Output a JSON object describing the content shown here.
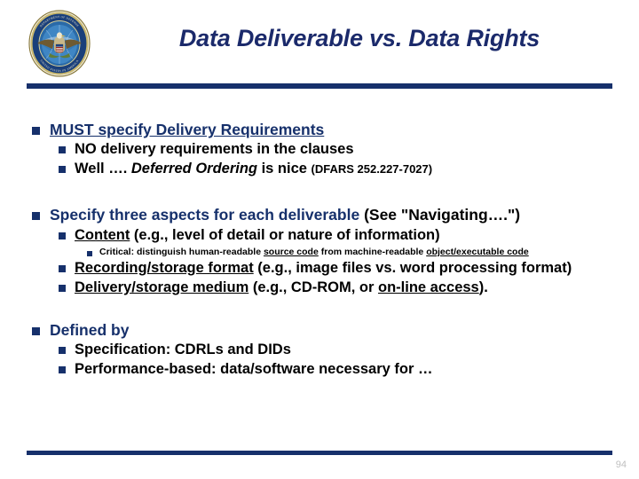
{
  "slide": {
    "title": "Data Deliverable vs. Data Rights",
    "page_number": "94",
    "accent_color": "#16306b",
    "title_color": "#1b2a6b",
    "seal_name": "department-of-defense-seal",
    "seal_text_top": "DEPARTMENT OF DEFENSE",
    "seal_text_bottom": "UNITED STATES OF AMERICA"
  },
  "bullets": {
    "b1": {
      "heading": "MUST specify Delivery Requirements",
      "sub1": "NO delivery requirements in the clauses",
      "sub2_a": "Well …. ",
      "sub2_b": "Deferred Ordering",
      "sub2_c": " is nice ",
      "sub2_ref": "(DFARS 252.227-7027)"
    },
    "b2": {
      "heading_blue": "Specify three aspects for each deliverable",
      "heading_black": " (See \"Navigating….\")",
      "sub1_u": "Content",
      "sub1_rest": " (e.g., level of detail or nature of information)",
      "sub1_critical_a": "Critical:  distinguish human-readable ",
      "sub1_critical_u1": "source code",
      "sub1_critical_b": " from machine-readable ",
      "sub1_critical_u2": "object/executable code",
      "sub2_u": "Recording/storage format",
      "sub2_rest": " (e.g., image files vs. word processing format)",
      "sub3_u": "Delivery/storage medium",
      "sub3_mid": " (e.g., CD-ROM, or ",
      "sub3_u2": "on-line access",
      "sub3_end": ")."
    },
    "b3": {
      "heading": "Defined by",
      "sub1": "Specification:  CDRLs and DIDs",
      "sub2": "Performance-based:  data/software necessary for …"
    }
  }
}
